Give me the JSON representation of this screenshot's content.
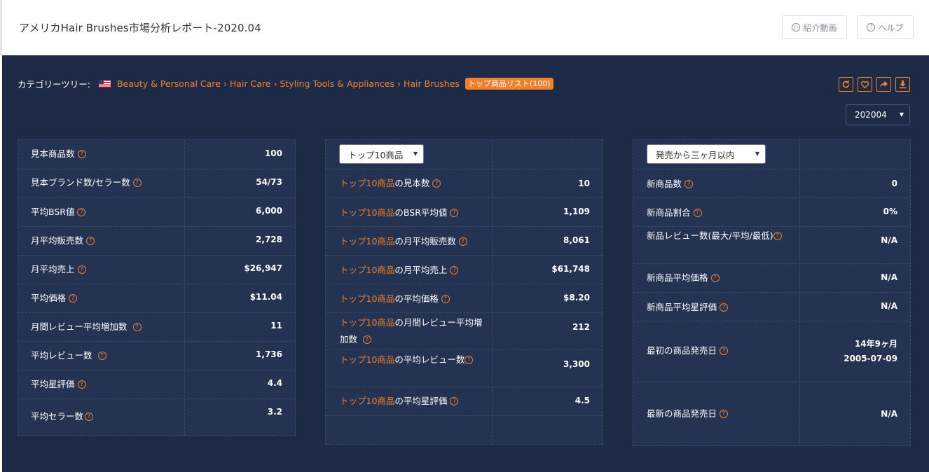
{
  "header": {
    "title": "アメリカHair Brushes市場分析レポート-2020.04",
    "intro_video_label": "紹介動画",
    "help_label": "ヘルプ"
  },
  "breadcrumb": {
    "label": "カテゴリーツリー:",
    "items": [
      "Beauty & Personal Care",
      "Hair Care",
      "Styling Tools & Appliances",
      "Hair Brushes"
    ],
    "separator": "›",
    "badge": "トップ商品リスト(100)"
  },
  "tools": [
    "refresh-icon",
    "heart-icon",
    "share-icon",
    "download-icon"
  ],
  "date_select": {
    "value": "202004"
  },
  "colors": {
    "accent": "#f0812c",
    "background": "#1e2b47",
    "panel": "#243352"
  },
  "panel_left": {
    "rows": [
      {
        "label": "見本商品数",
        "value": "100"
      },
      {
        "label": "見本ブランド数/セラー数",
        "value": "54/73"
      },
      {
        "label": "平均BSR値",
        "value": "6,000"
      },
      {
        "label": "月平均販売数",
        "value": "2,728"
      },
      {
        "label": "月平均売上",
        "value": "$26,947"
      },
      {
        "label": "平均価格",
        "value": "$11.04"
      },
      {
        "label": "月間レビュー平均増加数",
        "value": "11"
      },
      {
        "label": "平均レビュー数",
        "value": "1,736"
      },
      {
        "label": "平均星評価",
        "value": "4.4"
      },
      {
        "label": "平均セラー数",
        "value": "3.2"
      }
    ]
  },
  "panel_mid": {
    "select_value": "トップ10商品",
    "prefix": "トップ10商品",
    "rows": [
      {
        "suffix": "の見本数",
        "value": "10"
      },
      {
        "suffix": "のBSR平均値",
        "value": "1,109"
      },
      {
        "suffix": "の月平均販売数",
        "value": "8,061"
      },
      {
        "suffix": "の月平均売上",
        "value": "$61,748"
      },
      {
        "suffix": "の平均価格",
        "value": "$8.20"
      },
      {
        "suffix": "の月間レビュー平均増加数",
        "value": "212"
      },
      {
        "suffix": "の平均レビュー数",
        "value": "3,300"
      },
      {
        "suffix": "の平均星評価",
        "value": "4.5"
      }
    ]
  },
  "panel_right": {
    "select_value": "発売から三ヶ月以内",
    "rows": [
      {
        "label": "新商品数",
        "value": "0"
      },
      {
        "label": "新商品割合",
        "value": "0%"
      },
      {
        "label": "新品レビュー数(最大/平均/最低)",
        "value": "N/A"
      },
      {
        "label": "新商品平均価格",
        "value": "N/A"
      },
      {
        "label": "新商品平均星評価",
        "value": "N/A"
      },
      {
        "label": "最初の商品発売日",
        "value": "14年9ヶ月",
        "value2": "2005-07-09"
      },
      {
        "label": "最新の商品発売日",
        "value": "N/A"
      }
    ]
  }
}
